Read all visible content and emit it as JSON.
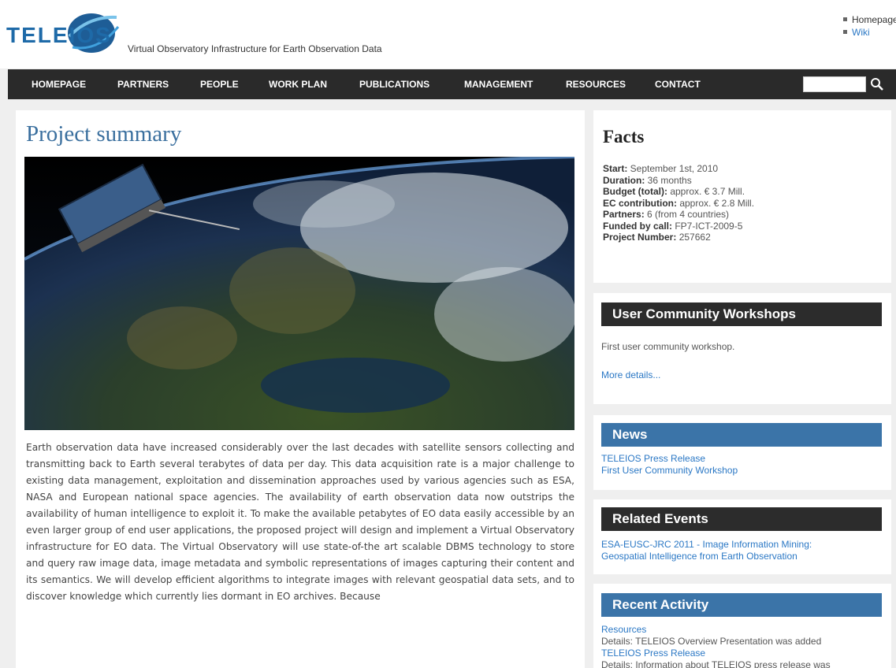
{
  "header": {
    "logo_text": "TELEIOS",
    "tagline": "Virtual Observatory Infrastructure for Earth Observation Data",
    "top_links": [
      "Homepage",
      "Wiki"
    ]
  },
  "nav": {
    "items": [
      "HOMEPAGE",
      "PARTNERS",
      "PEOPLE",
      "WORK PLAN",
      "PUBLICATIONS",
      "MANAGEMENT",
      "RESOURCES",
      "CONTACT"
    ],
    "search_value": ""
  },
  "main": {
    "title": "Project summary",
    "body": "Earth observation data have increased considerably over the last decades with satellite sensors collecting and transmitting back to Earth several terabytes of data per day. This data acquisition rate is a major challenge to existing data management, exploitation and dissemination approaches used by various agencies such as ESA, NASA and European national space agencies. The availability of earth observation data now outstrips the availability of human intelligence to exploit it. To make the available petabytes of EO data easily accessible by an even larger group of end user applications, the proposed project will design and implement a Virtual Observatory infrastructure for EO data. The Virtual Observatory will use state-of-the art scalable DBMS technology to store and query raw image data, image metadata and symbolic representations of images capturing their content and its semantics. We will develop efficient algorithms to integrate images with relevant geospatial data sets, and to discover knowledge which currently lies dormant in EO archives. Because"
  },
  "facts": {
    "title": "Facts",
    "rows": [
      {
        "label": "Start:",
        "value": " September 1st, 2010"
      },
      {
        "label": "Duration:",
        "value": " 36 months"
      },
      {
        "label": "Budget (total):",
        "value": " approx. € 3.7 Mill."
      },
      {
        "label": "EC contribution:",
        "value": " approx. € 2.8 Mill."
      },
      {
        "label": "Partners:",
        "value": " 6 (from 4 countries)"
      },
      {
        "label": "Funded by call:",
        "value": " FP7-ICT-2009-5"
      },
      {
        "label": "Project Number:",
        "value": " 257662"
      }
    ]
  },
  "workshops": {
    "title": "User Community Workshops",
    "text": "First user community workshop.",
    "link": "More details..."
  },
  "news": {
    "title": "News",
    "links": [
      "TELEIOS Press Release",
      "First User Community Workshop"
    ]
  },
  "events": {
    "title": "Related Events",
    "links": [
      "ESA-EUSC-JRC 2011 - Image Information Mining:",
      "Geospatial Intelligence from Earth Observation"
    ]
  },
  "activity": {
    "title": "Recent Activity",
    "items": [
      {
        "text": "Resources",
        "kind": "link"
      },
      {
        "text": "Details: TELEIOS Overview Presentation was added",
        "kind": "text"
      },
      {
        "text": "TELEIOS Press Release",
        "kind": "link"
      },
      {
        "text": "Details: Information about TELEIOS press release was",
        "kind": "text"
      }
    ]
  },
  "colors": {
    "nav_bg": "#2a2a2a",
    "accent_blue": "#3b74a8",
    "link": "#2b78c5",
    "title": "#3a6f9e"
  }
}
